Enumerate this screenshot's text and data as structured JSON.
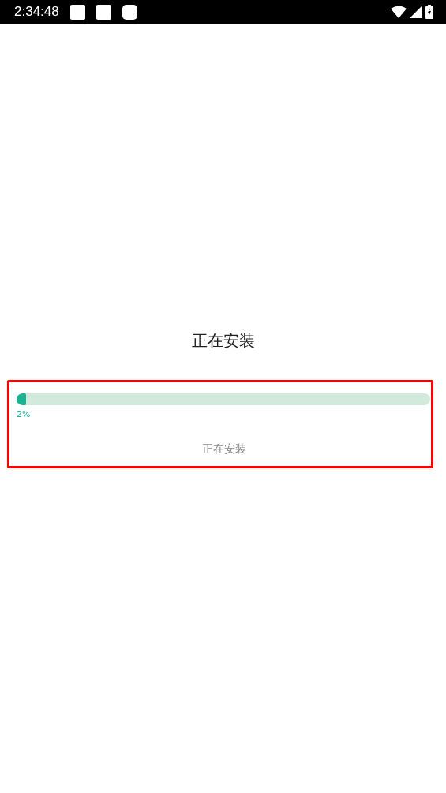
{
  "status_bar": {
    "time": "2:34:48"
  },
  "title": "正在安装",
  "install_panel": {
    "highlighted": true,
    "progress": {
      "level": 0.02,
      "reading": "2%"
    },
    "label": "正在安装"
  }
}
